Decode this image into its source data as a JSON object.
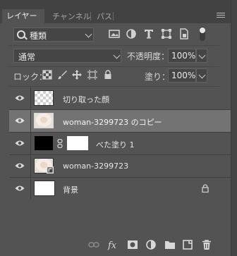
{
  "tabs": [
    {
      "label": "レイヤー",
      "active": true
    },
    {
      "label": "チャンネル",
      "active": false
    },
    {
      "label": "パス",
      "active": false
    }
  ],
  "filter": {
    "label": "種類"
  },
  "blend": {
    "mode": "通常",
    "opacity_label": "不透明度：",
    "opacity_value": "100%"
  },
  "lock": {
    "label": "ロック：",
    "fill_label": "塗り：",
    "fill_value": "100%"
  },
  "layers": [
    {
      "name": "切り取った顔",
      "thumb": "transparent",
      "selected": false
    },
    {
      "name": "woman-3299723 のコピー",
      "thumb": "photo",
      "selected": true
    },
    {
      "name": "べた塗り 1",
      "thumb": "fill",
      "selected": false
    },
    {
      "name": "woman-3299723",
      "thumb": "photo-smart",
      "selected": false
    },
    {
      "name": "背景",
      "thumb": "white",
      "selected": false,
      "locked": true
    }
  ],
  "colors": {
    "panel": "#535353",
    "selected_row": "#737373",
    "tabbar": "#424242"
  }
}
